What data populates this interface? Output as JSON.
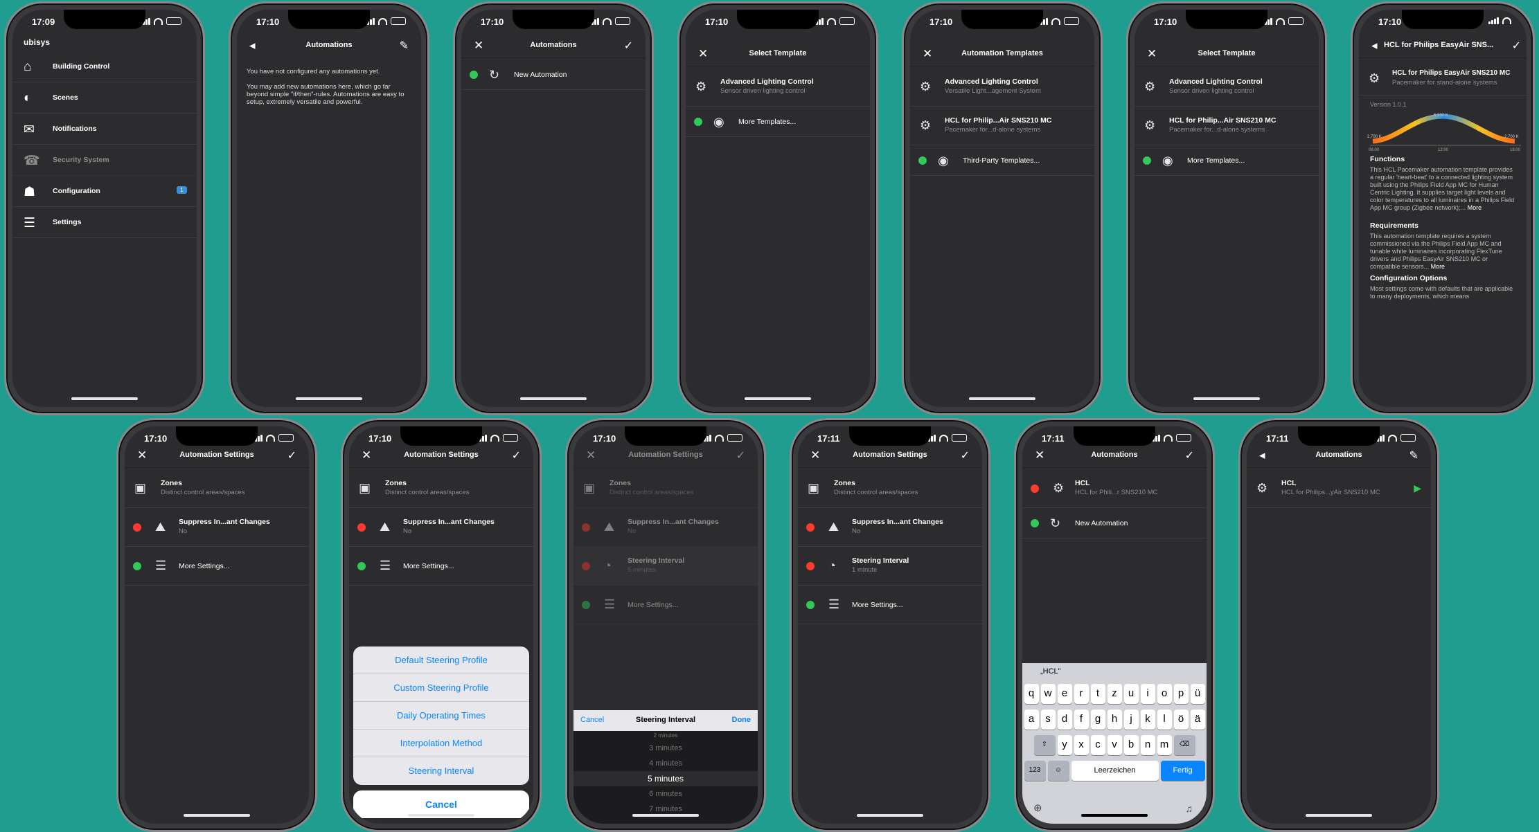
{
  "background": "#1f9d8f",
  "phones": [
    {
      "time": "17:09",
      "logo": "ubisys",
      "menu": [
        {
          "icon": "house-icon",
          "glyph": "⌂",
          "label": "Building Control"
        },
        {
          "icon": "scenes-icon",
          "glyph": "◐",
          "label": "Scenes"
        },
        {
          "icon": "envelope-icon",
          "glyph": "✉",
          "label": "Notifications"
        },
        {
          "icon": "alarm-icon",
          "glyph": "☎",
          "label": "Security System"
        },
        {
          "icon": "person-icon",
          "glyph": "☗",
          "label": "Configuration",
          "badge": "1"
        },
        {
          "icon": "list-icon",
          "glyph": "☰",
          "label": "Settings"
        }
      ]
    },
    {
      "time": "17:10",
      "title": "Automations",
      "empty_1": "You have not configured any automations yet.",
      "empty_2": "You may add new automations here, which go far beyond simple \"if/then\"-rules. Automations are easy to setup, extremely versatile and powerful."
    },
    {
      "time": "17:10",
      "title": "Automations",
      "new_label": "New Automation"
    },
    {
      "time": "17:10",
      "title": "Select Template",
      "item1_title": "Advanced Lighting Control",
      "item1_sub": "Sensor driven lighting control",
      "more": "More Templates..."
    },
    {
      "time": "17:10",
      "title": "Automation Templates",
      "item1_title": "Advanced Lighting Control",
      "item1_sub": "Versatile Light...agement System",
      "item2_title": "HCL for Philip...Air SNS210 MC",
      "item2_sub": "Pacemaker for...d-alone systems",
      "more": "Third-Party Templates..."
    },
    {
      "time": "17:10",
      "title": "Select Template",
      "item1_title": "Advanced Lighting Control",
      "item1_sub": "Sensor driven lighting control",
      "item2_title": "HCL for Philip...Air SNS210 MC",
      "item2_sub": "Pacemaker for...d-alone systems",
      "more": "More Templates..."
    },
    {
      "time": "17:10",
      "title": "HCL for Philips EasyAir SNS...",
      "item_title": "HCL for Philips EasyAir SNS210 MC",
      "item_sub": "Pacemaker for stand-alone systems",
      "version": "Version 1.0.1",
      "curve": {
        "peak": "6,500 K",
        "left": "2,700 K",
        "right": "2,700 K",
        "x0": "06:00",
        "x1": "12:00",
        "x2": "18:00"
      },
      "functions_h": "Functions",
      "functions_t": "This HCL Pacemaker automation template provides a regular 'heart-beat' to a connected lighting system built using the Philips Field App MC for Human Centric Lighting. It supplies target light levels and color temperatures to all luminaires in a Philips Field App MC group (Zigbee network);...",
      "requirements_h": "Requirements",
      "requirements_t": "This automation template requires a system commissioned via the Philips Field App MC and tunable white luminaires incorporating FlexTune drivers and Philips EasyAir SNS210 MC or compatible sensors...",
      "config_h": "Configuration Options",
      "config_t": "Most settings come with defaults that are applicable to many deployments, which means",
      "more": "More"
    },
    {
      "time": "17:10",
      "title": "Automation Settings",
      "zones": "Zones",
      "zones_sub": "Distinct control areas/spaces",
      "suppress": "Suppress In...ant Changes",
      "suppress_sub": "No",
      "more": "More Settings..."
    },
    {
      "time": "17:10",
      "title": "Automation Settings",
      "zones": "Zones",
      "zones_sub": "Distinct control areas/spaces",
      "suppress": "Suppress In...ant Changes",
      "suppress_sub": "No",
      "more": "More Settings...",
      "options": [
        "Default Steering Profile",
        "Custom Steering Profile",
        "Daily Operating Times",
        "Interpolation Method",
        "Steering Interval"
      ],
      "cancel": "Cancel"
    },
    {
      "time": "17:10",
      "title": "Automation Settings",
      "zones": "Zones",
      "zones_sub": "Distinct control areas/spaces",
      "suppress": "Suppress In...ant Changes",
      "suppress_sub": "No",
      "interval": "Steering Interval",
      "interval_sub": "5 minutes",
      "more": "More Settings...",
      "bar_cancel": "Cancel",
      "bar_title": "Steering Interval",
      "bar_done": "Done",
      "picker": [
        "2 minutes",
        "3 minutes",
        "4 minutes",
        "5 minutes",
        "6 minutes",
        "7 minutes"
      ]
    },
    {
      "time": "17:11",
      "title": "Automation Settings",
      "zones": "Zones",
      "zones_sub": "Distinct control areas/spaces",
      "suppress": "Suppress In...ant Changes",
      "suppress_sub": "No",
      "interval": "Steering Interval",
      "interval_sub": "1 minute",
      "more": "More Settings..."
    },
    {
      "time": "17:11",
      "title": "Automations",
      "hcl": "HCL",
      "hcl_sub": "HCL for Phili...r SNS210 MC",
      "new_label": "New Automation",
      "suggestion": "„HCL\"",
      "keys_row1": [
        "q",
        "w",
        "e",
        "r",
        "t",
        "z",
        "u",
        "i",
        "o",
        "p",
        "ü"
      ],
      "keys_row2": [
        "a",
        "s",
        "d",
        "f",
        "g",
        "h",
        "j",
        "k",
        "l",
        "ö",
        "ä"
      ],
      "keys_row3": [
        "y",
        "x",
        "c",
        "v",
        "b",
        "n",
        "m"
      ],
      "key_123": "123",
      "key_space": "Leerzeichen",
      "key_done": "Fertig"
    },
    {
      "time": "17:11",
      "title": "Automations",
      "hcl": "HCL",
      "hcl_sub": "HCL for Philips...yAir SNS210 MC"
    }
  ]
}
